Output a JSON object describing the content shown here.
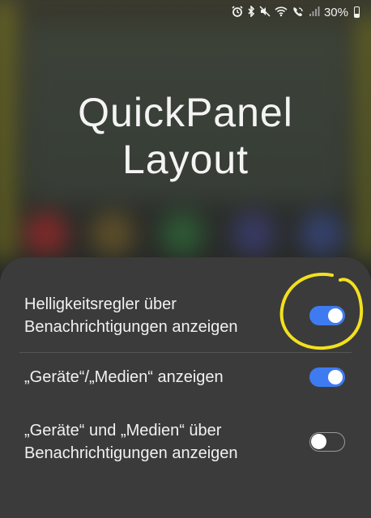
{
  "status_bar": {
    "icons": [
      "alarm-icon",
      "bluetooth-icon",
      "mute-icon",
      "wifi-icon",
      "wifi-call-icon",
      "signal-icon",
      "battery-icon"
    ],
    "battery_text": "30%"
  },
  "title": {
    "line1": "QuickPanel",
    "line2": "Layout"
  },
  "settings": [
    {
      "label": "Helligkeitsregler über Benachrichtigungen anzeigen",
      "state": "on"
    },
    {
      "label": "„Geräte“/„Medien“ anzeigen",
      "state": "on"
    },
    {
      "label": "„Geräte“ und „Medien“ über Benachrichtigungen anzeigen",
      "state": "off"
    }
  ],
  "colors": {
    "accent": "#3e7bf1",
    "annotation": "#f3e01d",
    "panel": "#3b3b3b"
  }
}
